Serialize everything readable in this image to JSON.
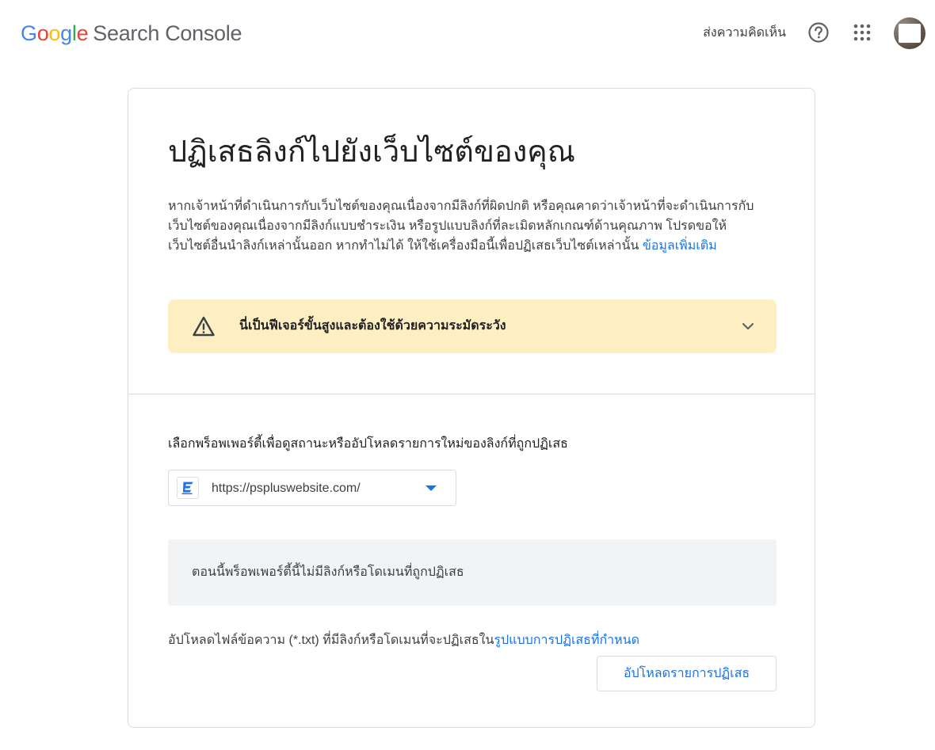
{
  "header": {
    "logo_google": "Google",
    "logo_product": "Search Console",
    "feedback_label": "ส่งความคิดเห็น"
  },
  "page": {
    "title": "ปฏิเสธลิงก์ไปยังเว็บไซต์ของคุณ",
    "description": "หากเจ้าหน้าที่ดำเนินการกับเว็บไซต์ของคุณเนื่องจากมีลิงก์ที่ผิดปกติ หรือคุณคาดว่าเจ้าหน้าที่จะดำเนินการกับเว็บไซต์ของคุณเนื่องจากมีลิงก์แบบชำระเงิน หรือรูปแบบลิงก์ที่ละเมิดหลักเกณฑ์ด้านคุณภาพ โปรดขอให้เว็บไซต์อื่นนำลิงก์เหล่านั้นออก หากทำไม่ได้ ให้ใช้เครื่องมือนี้เพื่อปฏิเสธเว็บไซต์เหล่านั้น",
    "learn_more": "ข้อมูลเพิ่มเติม"
  },
  "warning": {
    "text": "นี่เป็นฟีเจอร์ขั้นสูงและต้องใช้ด้วยความระมัดระวัง"
  },
  "property": {
    "label": "เลือกพร็อพเพอร์ตี้เพื่อดูสถานะหรืออัปโหลดรายการใหม่ของลิงก์ที่ถูกปฏิเสธ",
    "selected": "https://pspluswebsite.com/"
  },
  "status": {
    "empty_message": "ตอนนี้พร็อพเพอร์ตี้นี้ไม่มีลิงก์หรือโดเมนที่ถูกปฏิเสธ"
  },
  "upload": {
    "text": "อัปโหลดไฟล์ข้อความ (*.txt) ที่มีลิงก์หรือโดเมนที่จะปฏิเสธใน",
    "format_link": "รูปแบบการปฏิเสธที่กำหนด",
    "button_label": "อัปโหลดรายการปฏิเสธ"
  },
  "colors": {
    "google_blue": "#4285F4",
    "google_red": "#EA4335",
    "google_yellow": "#FBBC05",
    "google_green": "#34A853",
    "link": "#1a73e8",
    "warning_bg": "#feefc3"
  },
  "icons": [
    "help-icon",
    "apps-grid-icon",
    "avatar",
    "warning-triangle-icon",
    "chevron-down-icon",
    "site-favicon",
    "dropdown-caret-icon"
  ]
}
